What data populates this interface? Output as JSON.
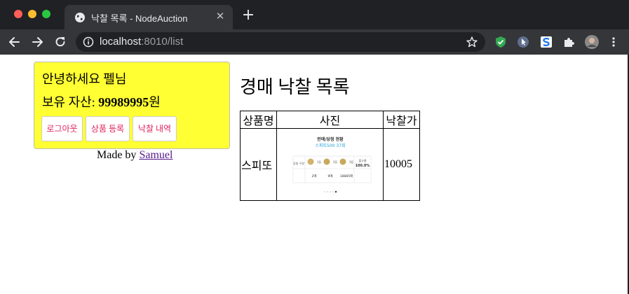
{
  "browser": {
    "tab_title": "낙찰 목록 - NodeAuction",
    "url_host": "localhost",
    "url_path": ":8010/list",
    "new_tab_label": "+",
    "tab_close_label": "✕"
  },
  "profile": {
    "greeting": "안녕하세요 펠님",
    "asset_label": "보유 자산:",
    "asset_value": "99989995",
    "asset_unit": "원",
    "buttons": [
      "로그아웃",
      "상품 등록",
      "낙찰 내역"
    ]
  },
  "footer": {
    "made_by_prefix": "Made by",
    "author": "Samuel"
  },
  "main": {
    "heading": "경매 낙찰 목록",
    "columns": [
      "상품명",
      "사진",
      "낙찰가"
    ],
    "rows": [
      {
        "name": "스피또",
        "price": "10005",
        "image": {
          "title": "판매/당첨 현황",
          "subtitle": "스피또500 37회",
          "row_label": "당첨 수량",
          "prize_labels": [
            "1등",
            "2등",
            "3등"
          ],
          "counts": [
            "2매",
            "9매",
            "18885매"
          ],
          "sales_label": "출고율",
          "sales_value": "100.0%"
        }
      }
    ]
  },
  "colors": {
    "profile_bg": "#ffff33",
    "button_text": "#e0245e",
    "link": "#551a8b"
  }
}
